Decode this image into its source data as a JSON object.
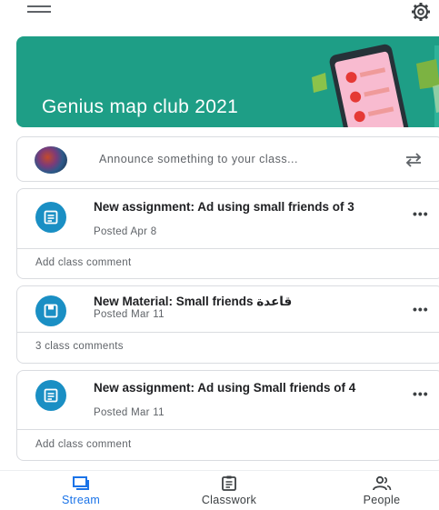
{
  "class": {
    "title": "Genius map club 2021"
  },
  "announce": {
    "placeholder": "Announce something to your class..."
  },
  "posts": [
    {
      "icon": "assignment-icon",
      "title": "New assignment: Ad using small friends of 3",
      "date": "Posted Apr 8",
      "comment": "Add class comment"
    },
    {
      "icon": "material-icon",
      "title": "New Material: Small friends قاعدة",
      "date": "Posted Mar 11",
      "comment": "3 class comments"
    },
    {
      "icon": "assignment-icon",
      "title": "New assignment: Ad using Small friends of 4",
      "date": "Posted Mar 11",
      "comment": "Add class comment"
    }
  ],
  "nav": {
    "stream": "Stream",
    "classwork": "Classwork",
    "people": "People"
  },
  "colors": {
    "banner": "#1e9e86",
    "accent": "#1a73e8",
    "post_icon": "#1a8fc4"
  }
}
